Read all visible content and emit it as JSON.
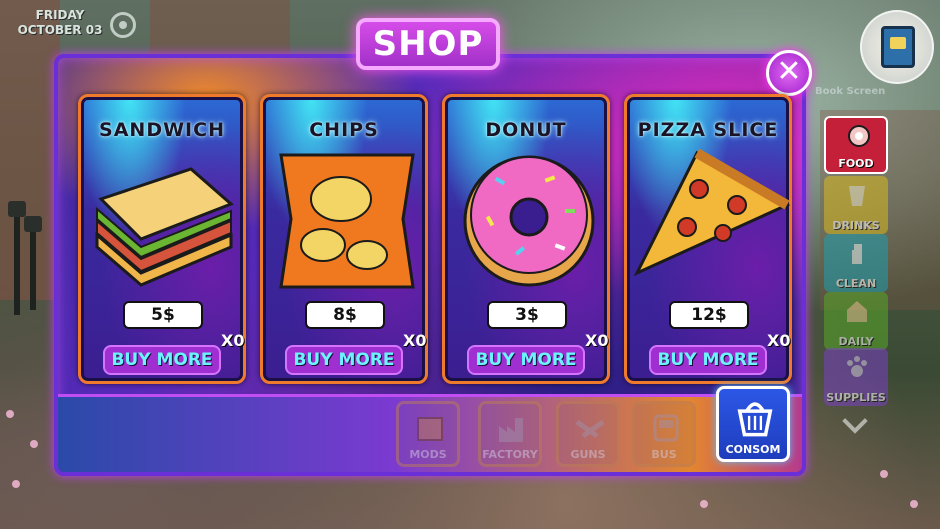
{
  "hud": {
    "date_day": "FRIDAY",
    "date_month": "OCTOBER 03",
    "faded_label": "Book Screen"
  },
  "shop": {
    "title": "SHOP",
    "close_symbol": "✕",
    "items": [
      {
        "name": "SANDWICH",
        "price": "5$",
        "quantity": "X0",
        "buy_label": "BUY MORE",
        "icon": "sandwich-icon"
      },
      {
        "name": "CHIPS",
        "price": "8$",
        "quantity": "X0",
        "buy_label": "BUY MORE",
        "icon": "chips-icon"
      },
      {
        "name": "DONUT",
        "price": "3$",
        "quantity": "X0",
        "buy_label": "BUY MORE",
        "icon": "donut-icon"
      },
      {
        "name": "PIZZA SLICE",
        "price": "12$",
        "quantity": "X0",
        "buy_label": "BUY MORE",
        "icon": "pizza-slice-icon"
      }
    ],
    "categories": [
      {
        "label": "MODS",
        "icon": "mods-icon"
      },
      {
        "label": "FACTORY",
        "icon": "factory-icon"
      },
      {
        "label": "GUNS",
        "icon": "guns-icon"
      },
      {
        "label": "BUS",
        "icon": "bus-icon"
      },
      {
        "label": "CONSOM",
        "icon": "basket-icon",
        "active": true
      }
    ]
  },
  "sidebar": {
    "items": [
      {
        "label": "FOOD",
        "icon": "meat-icon",
        "color": "#c4203a",
        "active": true
      },
      {
        "label": "DRINKS",
        "icon": "cup-icon",
        "color": "#d6b91f"
      },
      {
        "label": "CLEAN",
        "icon": "spray-bottle-icon",
        "color": "#1f9fb0"
      },
      {
        "label": "DAILY",
        "icon": "house-icon",
        "color": "#58a728"
      },
      {
        "label": "SUPPLIES",
        "icon": "paw-icon",
        "color": "#7a3fc4"
      }
    ]
  },
  "colors": {
    "panel_border": "#6a2fd6",
    "buy_text": "#6cf3ff",
    "buy_bg": "#9f2fd1",
    "card_border": "#f07a2b"
  }
}
